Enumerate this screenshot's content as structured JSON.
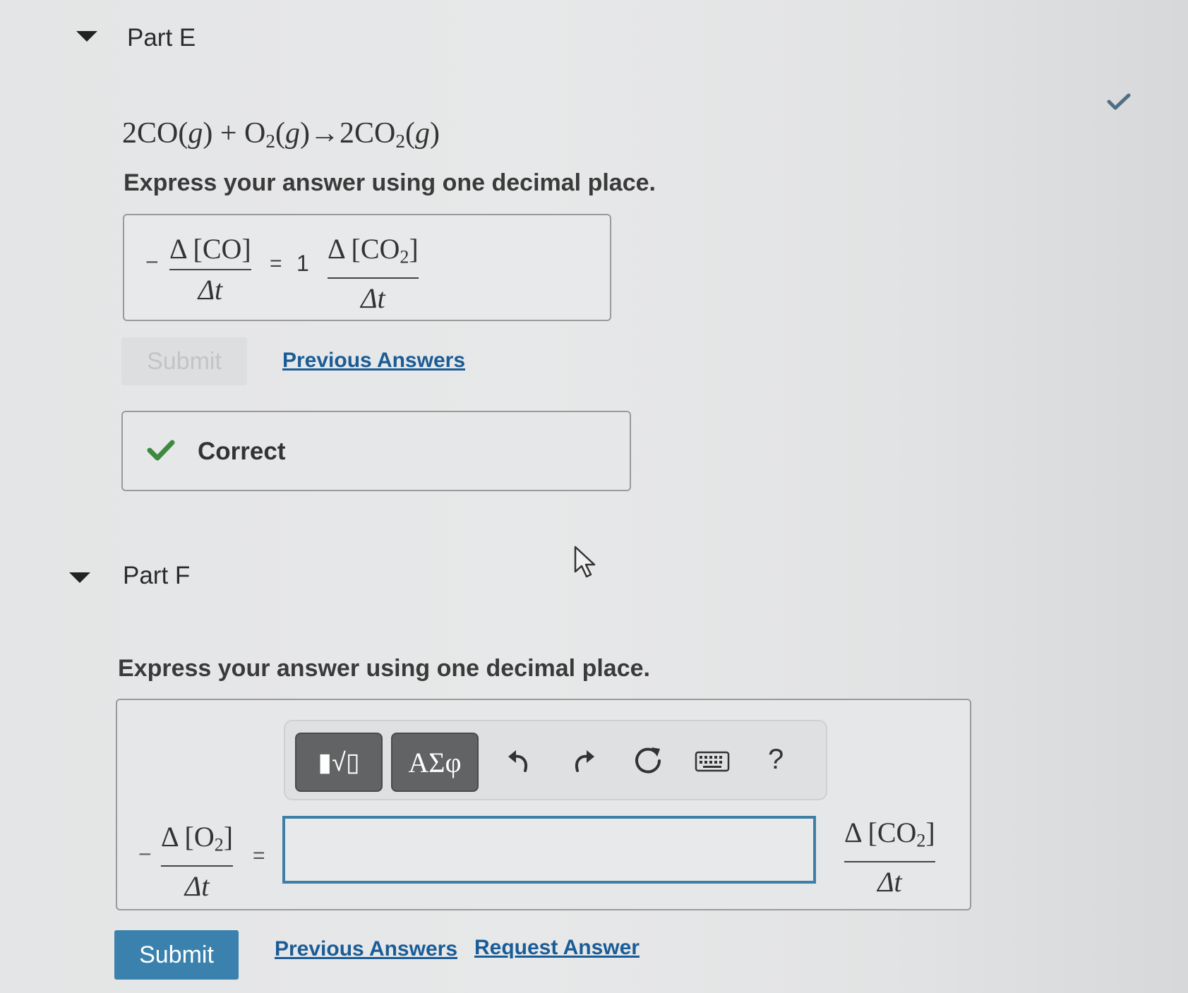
{
  "part_e": {
    "title": "Part E",
    "equation": {
      "lhs_a": "2CO(",
      "lhs_a_phase": "g",
      "plus": ") + O",
      "sub1": "2",
      "lhs_b": "(",
      "lhs_b_phase": "g",
      "arrow": ")→2CO",
      "sub2": "2",
      "rhs_a": "(",
      "rhs_phase": "g",
      "rhs_close": ")"
    },
    "instruction": "Express your answer using one decimal place.",
    "answer": {
      "neg_sign": "−",
      "left_num": "Δ [CO]",
      "left_den": "Δt",
      "equals": "=",
      "coefficient": "1",
      "right_num_prefix": "Δ [CO",
      "right_num_sub": "2",
      "right_num_suffix": "]",
      "right_den": "Δt"
    },
    "submit_label": "Submit",
    "previous_answers_label": "Previous Answers",
    "feedback_label": "Correct",
    "feedback_color": "#3b8a3e"
  },
  "part_f": {
    "title": "Part F",
    "instruction": "Express your answer using one decimal place.",
    "toolbar": {
      "templates_label": "▮√▯",
      "symbols_label": "ΑΣφ",
      "undo": "undo-icon",
      "redo": "redo-icon",
      "reset": "reset-icon",
      "keyboard": "keyboard-icon",
      "help_label": "?"
    },
    "answer": {
      "neg_sign": "−",
      "left_num_prefix": "Δ [O",
      "left_num_sub": "2",
      "left_num_suffix": "]",
      "left_den": "Δt",
      "equals": "=",
      "input_value": "",
      "right_num_prefix": "Δ [CO",
      "right_num_sub": "2",
      "right_num_suffix": "]",
      "right_den": "Δt"
    },
    "submit_label": "Submit",
    "previous_answers_label": "Previous Answers",
    "request_answer_label": "Request Answer",
    "submit_color": "#3a82ad"
  }
}
